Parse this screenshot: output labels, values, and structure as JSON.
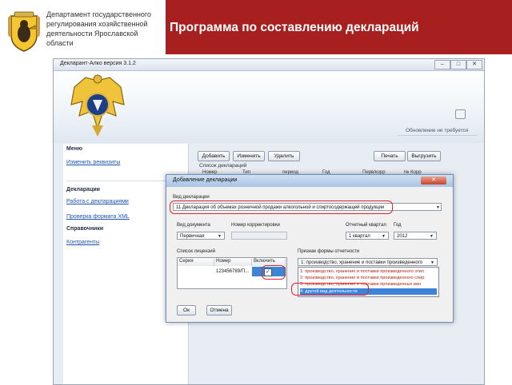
{
  "slide": {
    "department_lines": [
      "Департамент государственного",
      "регулирования хозяйственной",
      "деятельности Ярославской области"
    ],
    "title": "Программа по составлению деклараций"
  },
  "app": {
    "window_title": "Декларант-Алко версия 3.1.2",
    "updates_text": "Обновление не требуется",
    "menu": {
      "menu_header": "Меню",
      "edit_details": "Изменить реквизиты",
      "declarations_header": "Декларации",
      "work_with_declarations": "Работа с декларациями",
      "check_xml": "Проверка формата XML",
      "references_header": "Справочники",
      "counterparties": "Контрагенты"
    },
    "toolbar": {
      "add": "Добавить",
      "edit": "Изменить",
      "delete": "Удалить",
      "print": "Печать",
      "export": "Выгрузить"
    },
    "declarations_list": {
      "caption": "Список деклараций",
      "columns": [
        "Номер",
        "Тип",
        "период",
        "Год",
        "Перв/корр",
        "№ Корр"
      ]
    }
  },
  "dialog": {
    "title": "Добавление декларации",
    "close_glyph": "✕",
    "declaration_type_label": "Вид декларации",
    "declaration_type_value": "11 Декларация об объемах розничной продажи алкогольной и спиртосодержащей продукции",
    "doc_type_label": "Вид документа",
    "doc_type_value": "Первичная",
    "correction_number_label": "Номер корректировки",
    "correction_number_value": "",
    "quarter_label": "Отчетный квартал",
    "quarter_value": "1 квартал",
    "year_label": "Год",
    "year_value": "2012",
    "licenses_label": "Список лицензий",
    "licenses_columns": [
      "Серия",
      "Номер",
      "Включить"
    ],
    "licenses_rows": [
      {
        "series": "",
        "number": "123456789/П...",
        "include": "✓"
      }
    ],
    "form_sign_label": "Признак формы отчетности",
    "form_sign_selected": "1: производство, хранение и поставки произведенного",
    "form_sign_options": [
      "1: производство, хранение и поставки произведенного этил",
      "2: производство, хранение и поставки произведенного спир",
      "3: производство, хранение и поставки произведенных вин",
      "4: другой вид деятельности"
    ],
    "ok": "Ок",
    "cancel": "Отмена"
  },
  "colors": {
    "header_red": "#a7201f",
    "annotation_red": "#e0232a",
    "selection_blue": "#3b82d8"
  },
  "icons": [
    "coat-of-arms-emblem",
    "double-headed-eagle-emblem",
    "close-icon",
    "dropdown-arrow-icon",
    "checkmark-icon"
  ]
}
